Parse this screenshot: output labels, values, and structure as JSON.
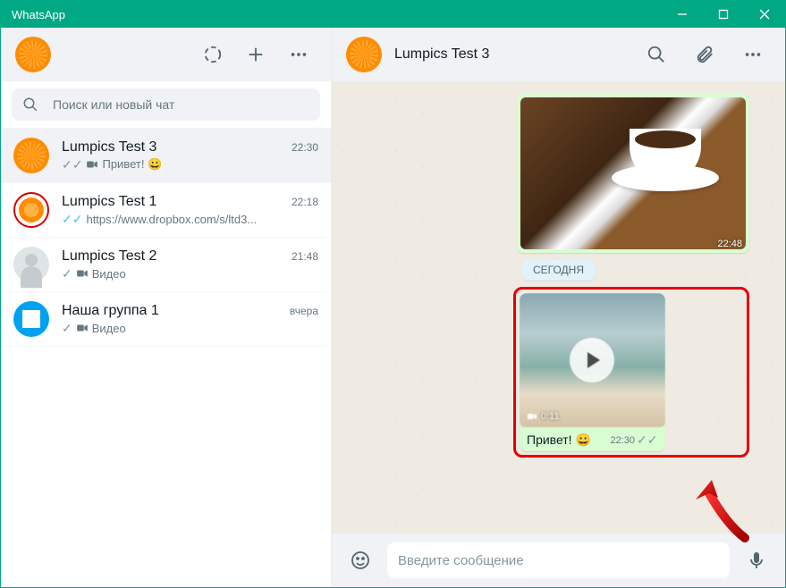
{
  "window": {
    "title": "WhatsApp"
  },
  "sidebar": {
    "search_placeholder": "Поиск или новый чат",
    "chats": [
      {
        "name": "Lumpics Test 3",
        "time": "22:30",
        "preview": "Привет! 😀",
        "check": "grey",
        "has_video_icon": true,
        "avatar": "orange",
        "active": true
      },
      {
        "name": "Lumpics Test 1",
        "time": "22:18",
        "preview": "https://www.dropbox.com/s/ltd3...",
        "check": "blue",
        "has_video_icon": false,
        "avatar": "orange-ring",
        "active": false
      },
      {
        "name": "Lumpics Test 2",
        "time": "21:48",
        "preview": "Видео",
        "check": "grey",
        "has_video_icon": true,
        "avatar": "grey",
        "active": false
      },
      {
        "name": "Наша группа 1",
        "time": "вчера",
        "preview": "Видео",
        "check": "grey",
        "has_video_icon": true,
        "avatar": "winblue",
        "active": false
      }
    ]
  },
  "chat": {
    "title": "Lumpics Test 3",
    "date_chip": "СЕГОДНЯ",
    "image_msg": {
      "time": "22:48"
    },
    "video_msg": {
      "duration": "0:11",
      "caption": "Привет! 😀",
      "time": "22:30"
    },
    "composer_placeholder": "Введите сообщение"
  }
}
